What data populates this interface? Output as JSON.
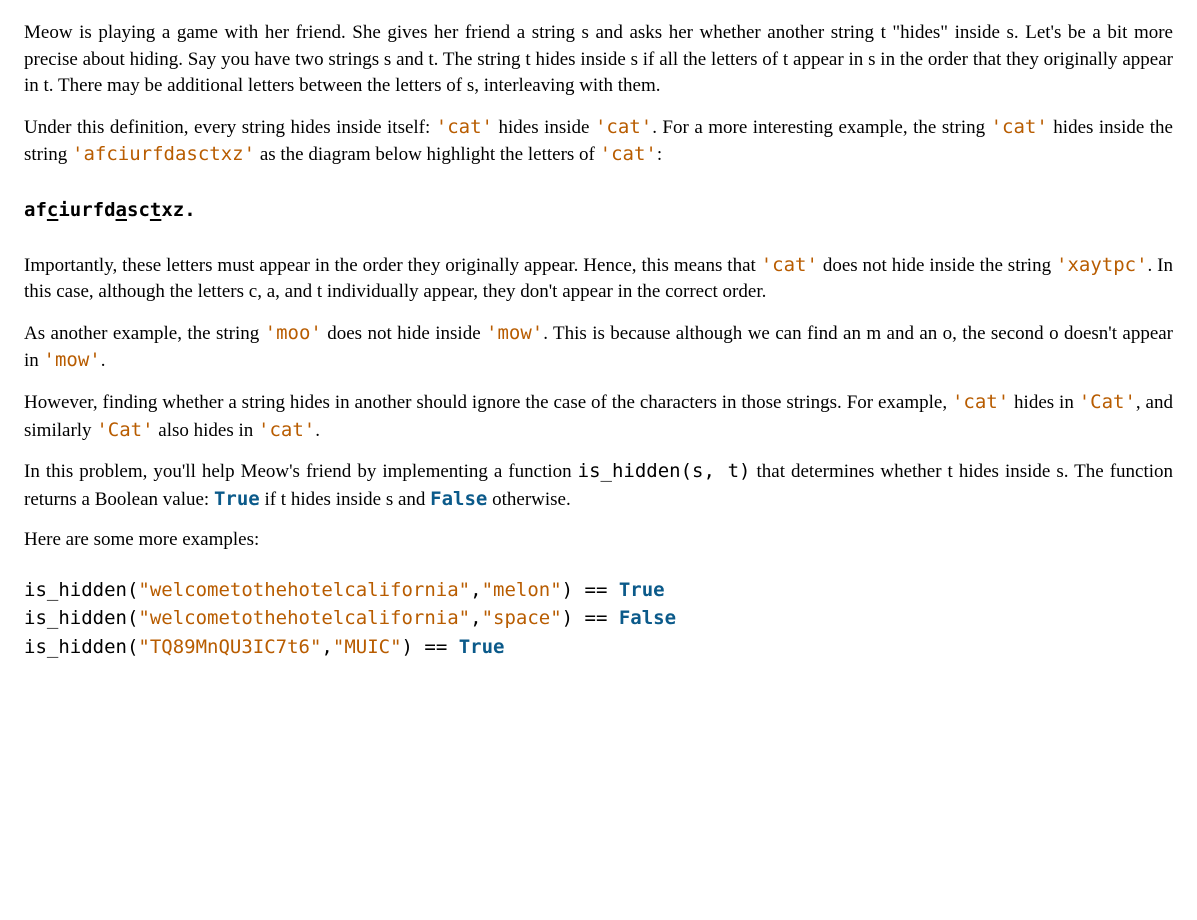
{
  "p1_a": "Meow is playing a game with her friend. She gives her friend a string s and asks her whether another string t \"hides\" inside s. Let's be a bit more precise about hiding. Say you have two strings s and t. The string t hides inside s if all the letters of t appear in s in the order that they originally appear in t. There may be additional letters between the letters of s, interleaving with them.",
  "p2_a": "Under this definition, every string hides inside itself: ",
  "p2_code1": "'cat'",
  "p2_b": " hides inside ",
  "p2_code2": "'cat'",
  "p2_c": ". For a more interesting example, the string ",
  "p2_code3": "'cat'",
  "p2_d": " hides inside the string ",
  "p2_code4": "'afciurfdasctxz'",
  "p2_e": " as the diagram below highlight the letters of ",
  "p2_code5": "'cat'",
  "p2_f": ":",
  "diagram": {
    "d1": "af",
    "h1": "c",
    "d2": "iurfd",
    "h2": "a",
    "d3": "sc",
    "h3": "t",
    "d4": "xz."
  },
  "p3_a": "Importantly, these letters must appear in the order they originally appear. Hence, this means that ",
  "p3_code1": "'cat'",
  "p3_b": " does not hide inside the string ",
  "p3_code2": "'xaytpc'",
  "p3_c": ". In this case, although the letters c, a, and t individually appear, they don't appear in the correct order.",
  "p4_a": "As another example, the string ",
  "p4_code1": "'moo'",
  "p4_b": " does not hide inside ",
  "p4_code2": "'mow'",
  "p4_c": ". This is because although we can find an m and an o, the second o doesn't appear in ",
  "p4_code3": "'mow'",
  "p4_d": ".",
  "p5_a": "However, finding whether a string hides in another should ignore the case of the characters in those strings. For example, ",
  "p5_code1": "'cat'",
  "p5_b": " hides in ",
  "p5_code2": "'Cat'",
  "p5_c": ", and similarly ",
  "p5_code3": "'Cat'",
  "p5_d": " also hides in ",
  "p5_code4": "'cat'",
  "p5_e": ".",
  "p6_a": "In this problem, you'll help Meow's friend by implementing a function ",
  "p6_code1": "is_hidden(s, t)",
  "p6_b": " that determines whether t hides inside s. The function returns a Boolean value: ",
  "p6_bool1": "True",
  "p6_c": " if t hides inside s and ",
  "p6_bool2": "False",
  "p6_d": " otherwise.",
  "p7_a": "Here are some more examples:",
  "ex": [
    {
      "fn": "is_hidden(",
      "s": "\"welcometothehotelcalifornia\"",
      "sep": ",",
      "t": "\"melon\"",
      "close": ") == ",
      "res": "True"
    },
    {
      "fn": "is_hidden(",
      "s": "\"welcometothehotelcalifornia\"",
      "sep": ",",
      "t": "\"space\"",
      "close": ") == ",
      "res": "False"
    },
    {
      "fn": "is_hidden(",
      "s": "\"TQ89MnQU3IC7t6\"",
      "sep": ",",
      "t": "\"MUIC\"",
      "close": ") == ",
      "res": "True"
    }
  ]
}
